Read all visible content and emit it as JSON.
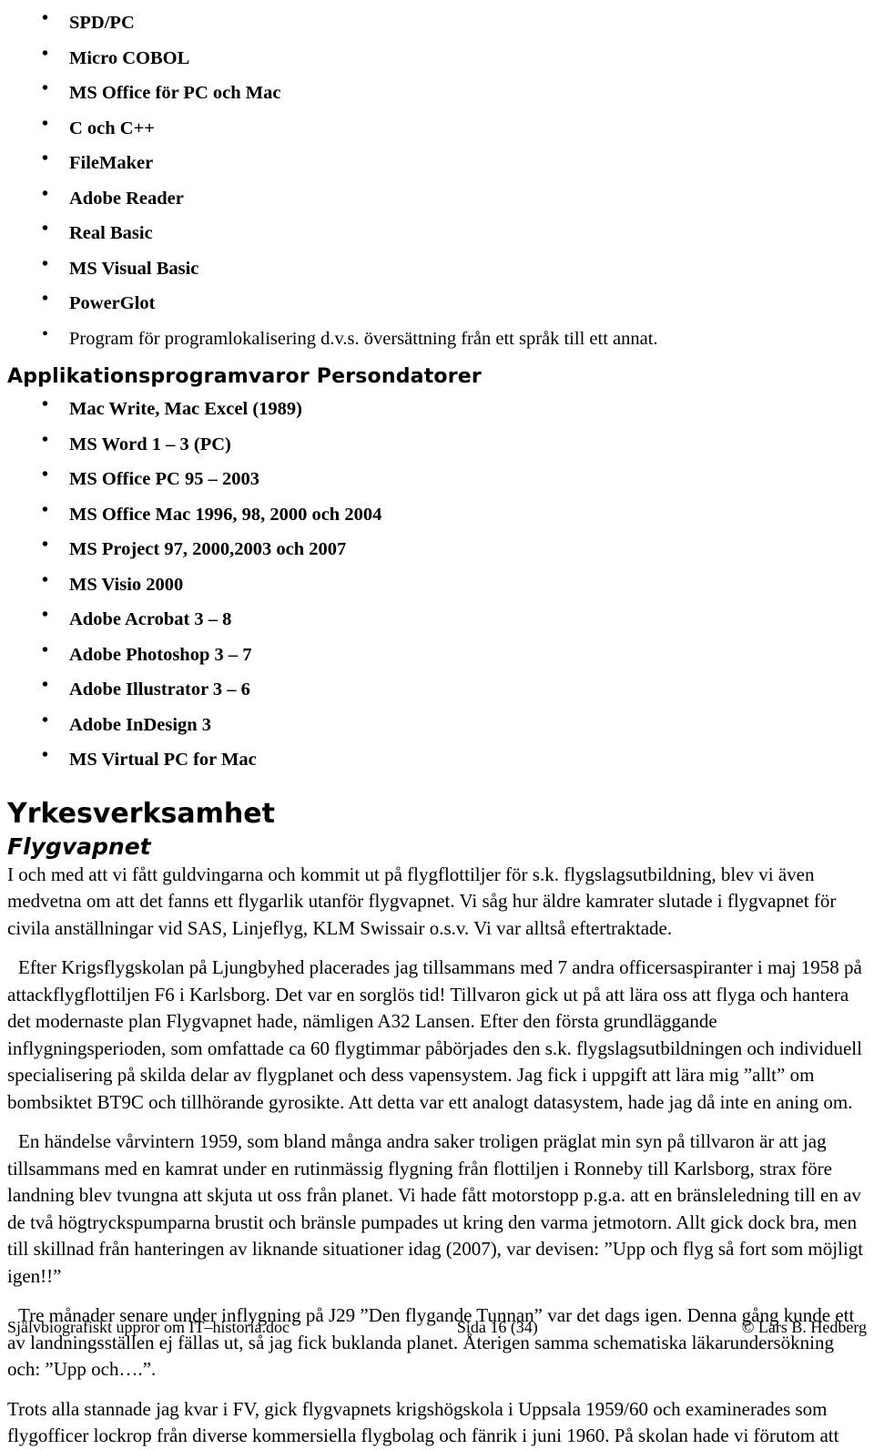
{
  "document": {
    "software_list": [
      {
        "label": "SPD/PC",
        "style": "bold"
      },
      {
        "label": "Micro COBOL",
        "style": "bold"
      },
      {
        "label": "MS Office för PC och Mac",
        "style": "bold"
      },
      {
        "label": "C och C++",
        "style": "bold"
      },
      {
        "label": "FileMaker",
        "style": "bold"
      },
      {
        "label": "Adobe Reader",
        "style": "bold"
      },
      {
        "label": "Real Basic",
        "style": "bold"
      },
      {
        "label": "MS Visual Basic",
        "style": "bold"
      },
      {
        "label": "PowerGlot",
        "style": "bold"
      },
      {
        "label": "Program för programlokalisering d.v.s. översättning från ett språk till ett annat.",
        "style": "plain"
      }
    ],
    "section_heading": "Applikationsprogramvaror Persondatorer",
    "app_list": [
      {
        "label": "Mac Write, Mac Excel (1989)"
      },
      {
        "label": "MS Word 1 – 3 (PC)"
      },
      {
        "label": "MS Office PC 95 – 2003"
      },
      {
        "label": "MS Office Mac 1996, 98, 2000 och  2004"
      },
      {
        "label": "MS Project 97, 2000,2003 och 2007"
      },
      {
        "label": "MS Visio 2000"
      },
      {
        "label": "Adobe Acrobat 3 – 8"
      },
      {
        "label": "Adobe Photoshop 3 – 7"
      },
      {
        "label": "Adobe Illustrator 3 – 6"
      },
      {
        "label": "Adobe InDesign 3"
      },
      {
        "label": "MS Virtual PC for Mac"
      }
    ],
    "chapter_heading": "Yrkesverksamhet",
    "sub_heading": "Flygvapnet",
    "paragraphs": [
      "I och med att vi fått guldvingarna och kommit ut på flygflottiljer för s.k. flygslagsutbildning, blev vi även medvetna om att det fanns ett flygarlik utanför flygvapnet. Vi såg hur äldre kamrater slutade i flygvapnet för civila anställningar vid SAS, Linjeflyg, KLM Swissair o.s.v. Vi var alltså eftertraktade.",
      "Efter Krigsflygskolan på Ljungbyhed placerades jag tillsammans med 7 andra officersaspiranter i maj 1958 på attackflygflottiljen F6 i Karlsborg. Det var en sorglös tid! Tillvaron gick ut på att lära oss att flyga och hantera det modernaste plan Flygvapnet hade, nämligen A32 Lansen. Efter den första grundläggande inflygningsperioden, som omfattade ca 60 flygtimmar påbörjades den s.k. flygslagsutbildningen och individuell specialisering på skilda delar av flygplanet och dess vapensystem. Jag fick i uppgift att lära mig ”allt” om bombsiktet BT9C och tillhörande gyrosikte. Att detta var ett analogt datasystem, hade jag då inte en aning om.",
      "En händelse vårvintern 1959, som bland många andra saker troligen präglat min syn på tillvaron är att jag tillsammans med en kamrat under en rutinmässig flygning från flottiljen i Ronneby till Karlsborg, strax före landning blev tvungna att skjuta ut oss från planet. Vi hade fått motorstopp p.g.a. att en bränsleledning till en av de två högtryckspumparna brustit och bränsle pumpades ut kring den varma jetmotorn. Allt gick dock bra, men till skillnad från hanteringen av liknande situationer idag (2007), var devisen: ”Upp och flyg så fort som möjligt igen!!”",
      "Tre månader senare under inflygning på J29 ”Den flygande Tunnan” var det dags igen. Denna gång kunde ett av landningsställen ej fällas ut, så jag fick buklanda planet. Återigen samma schematiska läkarundersökning  och: ”Upp och….”.",
      "Trots alla stannade jag kvar i FV, gick flygvapnets krigshögskola i Uppsala 1959/60 och examinerades som flygofficer lockrop från diverse kommersiella flygbolag och fänrik i juni 1960. På skolan hade vi förutom att"
    ]
  },
  "footer": {
    "left": "Självbiografiskt uppror om IT–historia.doc",
    "center": "Sida 16 (34)",
    "right": "© Lars B. Hedberg"
  }
}
